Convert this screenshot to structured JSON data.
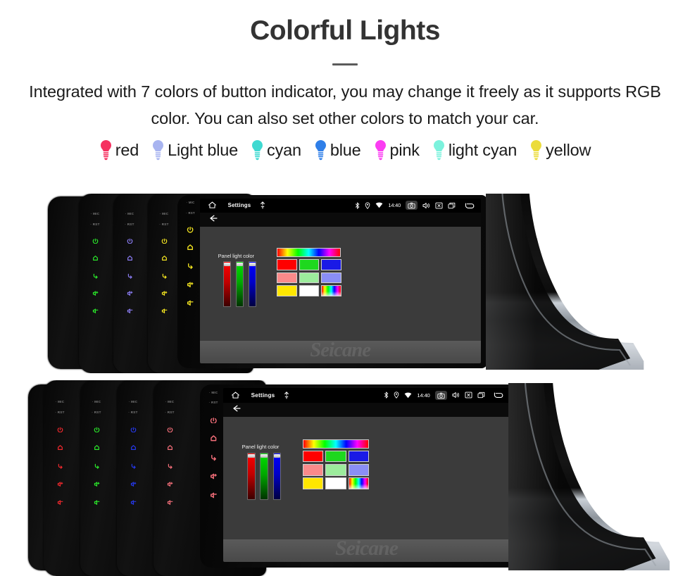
{
  "header": {
    "title": "Colorful Lights",
    "description": "Integrated with 7 colors of button indicator, you may change it freely as it supports RGB color. You can also set other colors to match your car."
  },
  "legend": {
    "items": [
      {
        "label": "red",
        "color": "#f5305f"
      },
      {
        "label": "Light blue",
        "color": "#a8b4f0"
      },
      {
        "label": "cyan",
        "color": "#3fd9d1"
      },
      {
        "label": "blue",
        "color": "#2f7fe8"
      },
      {
        "label": "pink",
        "color": "#fb3df2"
      },
      {
        "label": "light cyan",
        "color": "#7cf2dd"
      },
      {
        "label": "yellow",
        "color": "#ebdc3c"
      }
    ]
  },
  "device": {
    "key_labels": {
      "mic": "MIC",
      "reset": "RST"
    },
    "key_icons": [
      "power-icon",
      "home-icon",
      "back-icon",
      "volume-up-icon",
      "volume-down-icon"
    ],
    "statusbar": {
      "home_icon": "home-icon",
      "title": "Settings",
      "mic_icon": "microphone-icon",
      "bluetooth_icon": "bluetooth-icon",
      "location_icon": "location-icon",
      "wifi_icon": "wifi-icon",
      "time": "14:40",
      "screenshot_icon": "camera-icon",
      "volume_icon": "speaker-icon",
      "close_icon": "close-box-icon",
      "recents_icon": "recents-icon",
      "back_icon": "back-arrow-icon"
    },
    "backbar": {
      "back_icon": "back-arrow-icon"
    },
    "settings_screen": {
      "panel_label": "Panel light color",
      "sliders": [
        {
          "name": "red-slider",
          "color": "#ff0000",
          "value": 100
        },
        {
          "name": "green-slider",
          "color": "#00e000",
          "value": 100
        },
        {
          "name": "blue-slider",
          "color": "#0000ff",
          "value": 100
        }
      ],
      "swatch_rows": [
        [
          {
            "name": "hue-spectrum-swatch",
            "color": "hue-h"
          }
        ],
        [
          {
            "name": "swatch-red",
            "color": "#ff0000"
          },
          {
            "name": "swatch-green",
            "color": "#1ed81e"
          },
          {
            "name": "swatch-blue",
            "color": "#1a1ae6"
          }
        ],
        [
          {
            "name": "swatch-salmon",
            "color": "#fa8a8a"
          },
          {
            "name": "swatch-lightgreen",
            "color": "#9cec9c"
          },
          {
            "name": "swatch-periwinkle",
            "color": "#8a8ef5"
          }
        ],
        [
          {
            "name": "swatch-yellow",
            "color": "#ffe700"
          },
          {
            "name": "swatch-white",
            "color": "#ffffff"
          },
          {
            "name": "swatch-rainbow",
            "color": "hue-v"
          }
        ]
      ]
    },
    "watermark": "Seicane"
  },
  "rows": [
    {
      "name": "top-product-row",
      "stack_colors": [
        "#2ae52a",
        "#8a7cf2",
        "#f2e320"
      ],
      "stack_names": [
        "green-key-unit",
        "purple-key-unit",
        "yellow-key-unit"
      ]
    },
    {
      "name": "bottom-product-row",
      "stack_colors": [
        "#f0282d",
        "#2ae52a",
        "#2538e8",
        "#f56f7a"
      ],
      "stack_names": [
        "red-key-unit",
        "green-key-unit",
        "blue-key-unit",
        "salmon-key-unit"
      ]
    }
  ]
}
